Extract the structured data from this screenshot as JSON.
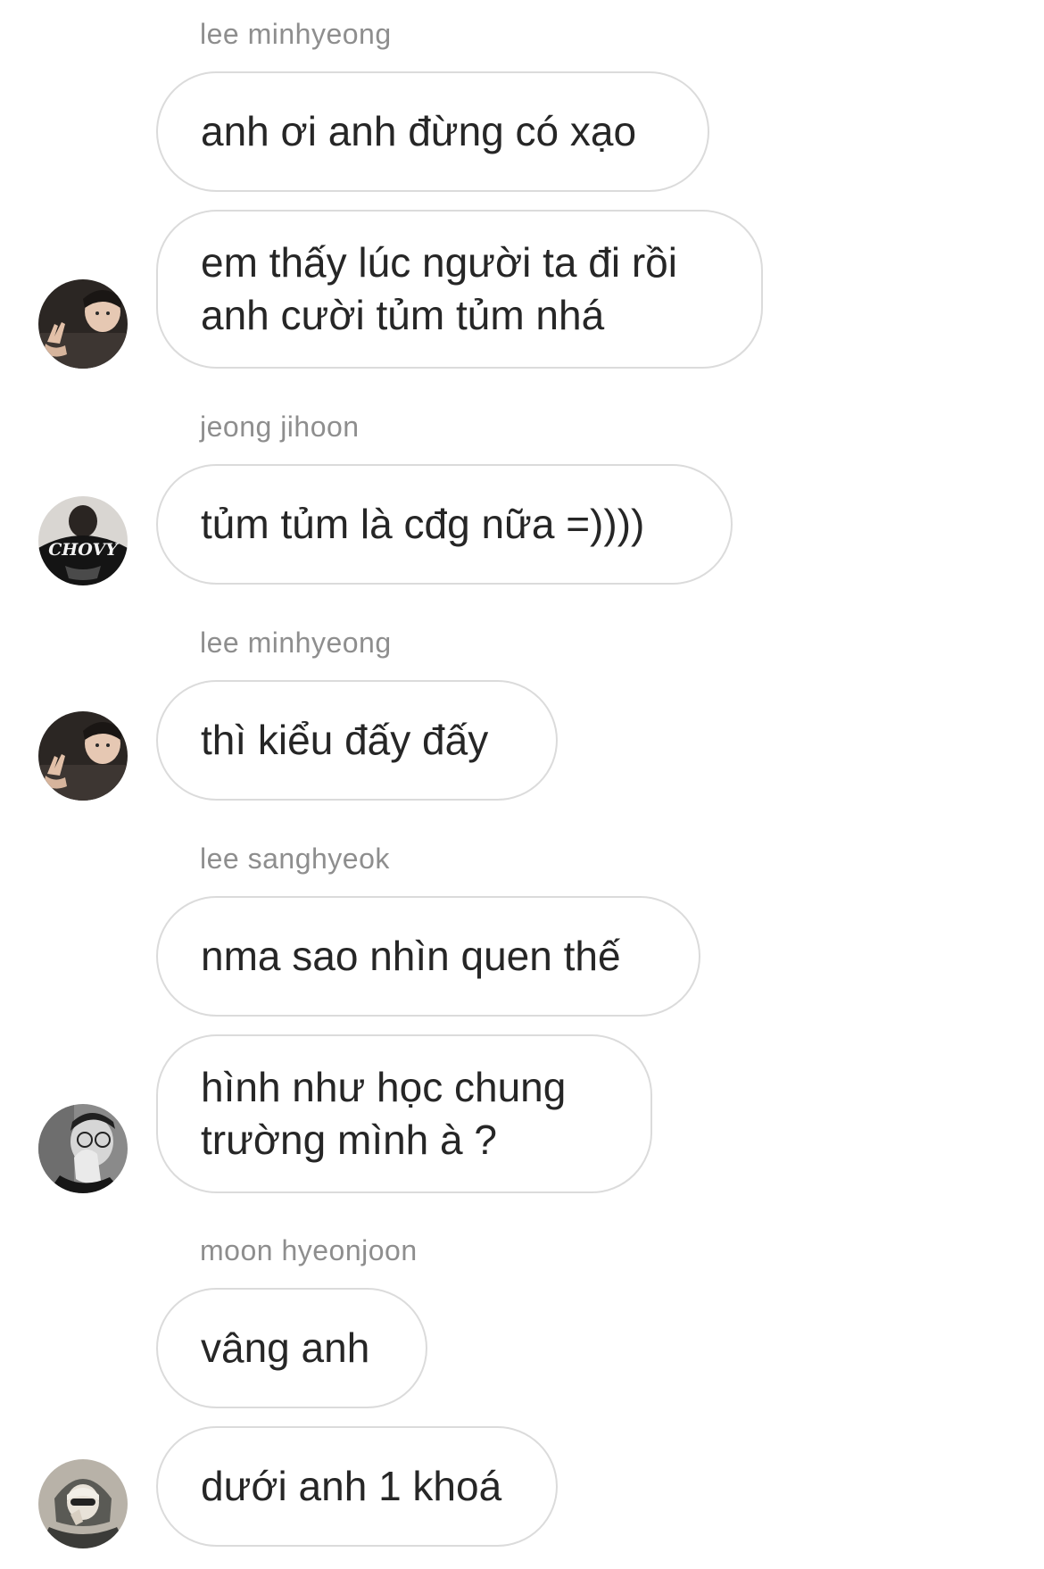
{
  "messages": [
    {
      "sender": "lee minhyeong",
      "bubbles": [
        [
          "anh ơi anh đừng có xạo"
        ],
        [
          "em thấy lúc người ta đi rồi",
          "anh cười tủm tủm nhá"
        ]
      ]
    },
    {
      "sender": "jeong jihoon",
      "bubbles": [
        [
          "tủm tủm là cđg nữa =))))"
        ]
      ]
    },
    {
      "sender": "lee minhyeong",
      "bubbles": [
        [
          "thì kiểu đấy đấy"
        ]
      ]
    },
    {
      "sender": "lee sanghyeok",
      "bubbles": [
        [
          "nma sao nhìn quen thế"
        ],
        [
          "hình như học chung",
          "trường mình à ?"
        ]
      ]
    },
    {
      "sender": "moon hyeonjoon",
      "bubbles": [
        [
          "vâng anh"
        ],
        [
          "dưới anh 1 khoá"
        ]
      ]
    }
  ],
  "avatars": {
    "a1": {
      "name": "avatar-lee-minhyeong",
      "icon": "profile-photo"
    },
    "a2": {
      "name": "avatar-jeong-jihoon",
      "icon": "profile-photo",
      "shirt_text": "CHOVY"
    },
    "a3": {
      "name": "avatar-lee-minhyeong",
      "icon": "profile-photo"
    },
    "a4": {
      "name": "avatar-lee-sanghyeok",
      "icon": "profile-photo"
    },
    "a5": {
      "name": "avatar-moon-hyeonjoon",
      "icon": "profile-photo"
    }
  },
  "colors": {
    "bubble_border": "#dbdbdb",
    "sender_name": "#8e8e8e",
    "message_text": "#262626",
    "background": "#ffffff"
  }
}
